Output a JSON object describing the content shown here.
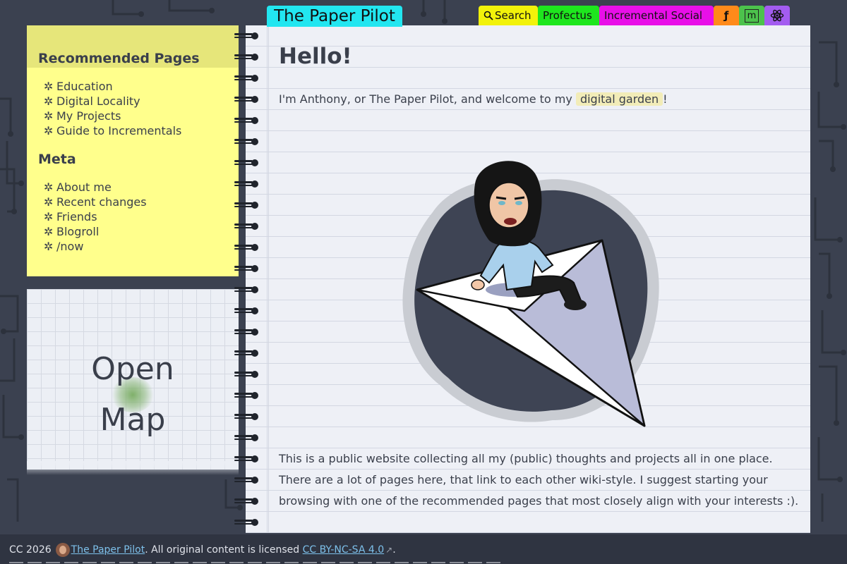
{
  "site": {
    "title": "The Paper Pilot"
  },
  "nav": {
    "search_label": "Search",
    "profectus_label": "Profectus",
    "social_label": "Incremental Social",
    "icons": [
      "search-icon",
      "f-icon",
      "matrix-icon",
      "atom-icon"
    ],
    "m_label": "m",
    "f_label": "ƒ"
  },
  "sidebar": {
    "recommended_title": "Recommended Pages",
    "recommended": [
      {
        "label": "Education"
      },
      {
        "label": "Digital Locality"
      },
      {
        "label": "My Projects"
      },
      {
        "label": "Guide to Incrementals"
      }
    ],
    "meta_title": "Meta",
    "meta": [
      {
        "label": "About me"
      },
      {
        "label": "Recent changes"
      },
      {
        "label": "Friends"
      },
      {
        "label": "Blogroll"
      },
      {
        "label": "/now"
      }
    ],
    "bullet": "✲"
  },
  "map": {
    "line1": "Open",
    "line2": "Map"
  },
  "main": {
    "heading": "Hello!",
    "intro_before": "I'm Anthony, or The Paper Pilot, and welcome to my",
    "intro_link": "digital garden",
    "intro_after": "!",
    "paragraphs": [
      "This is a public website collecting all my (public) thoughts and projects all in one place.",
      "There are a lot of pages here, that link to each other wiki-style. I suggest starting your",
      "browsing with one of the recommended pages that most closely align with your interests :)."
    ]
  },
  "footer": {
    "prefix": "CC 2026",
    "author": "The Paper Pilot",
    "middle": ". All original content is licensed",
    "license": "CC BY-NC-SA 4.0",
    "external_icon": "↗",
    "suffix": "."
  },
  "colors": {
    "background": "#3b4150",
    "title_tab": "#22e6f0",
    "search_tab": "#f2f20a",
    "profectus_tab": "#1ee61e",
    "social_tab": "#e80fe8",
    "f_tab": "#ff8a1a",
    "m_tab": "#4cc24c",
    "atom_tab": "#a35cf0",
    "sticky_note": "#ffff8c",
    "page": "#eef0f6",
    "link": "#7dc0ea"
  }
}
